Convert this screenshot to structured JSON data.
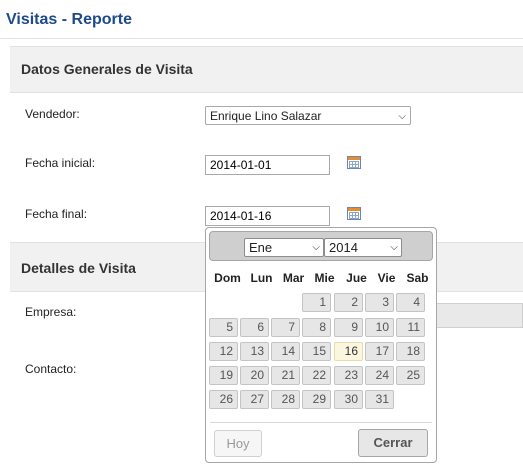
{
  "page": {
    "title": "Visitas - Reporte"
  },
  "general": {
    "title": "Datos Generales de Visita",
    "vendedor_label": "Vendedor:",
    "vendedor_value": "Enrique Lino Salazar",
    "fecha_inicial_label": "Fecha inicial:",
    "fecha_inicial_value": "2014-01-01",
    "fecha_final_label": "Fecha final:",
    "fecha_final_value": "2014-01-16"
  },
  "detalles": {
    "title": "Detalles de Visita",
    "empresa_label": "Empresa:",
    "contacto_label": "Contacto:"
  },
  "datepicker": {
    "month": "Ene",
    "year": "2014",
    "days_of_week": [
      "Dom",
      "Lun",
      "Mar",
      "Mie",
      "Jue",
      "Vie",
      "Sab"
    ],
    "first_weekday": 3,
    "days_in_month": 31,
    "selected_day": 16,
    "today_button": "Hoy",
    "close_button": "Cerrar"
  }
}
